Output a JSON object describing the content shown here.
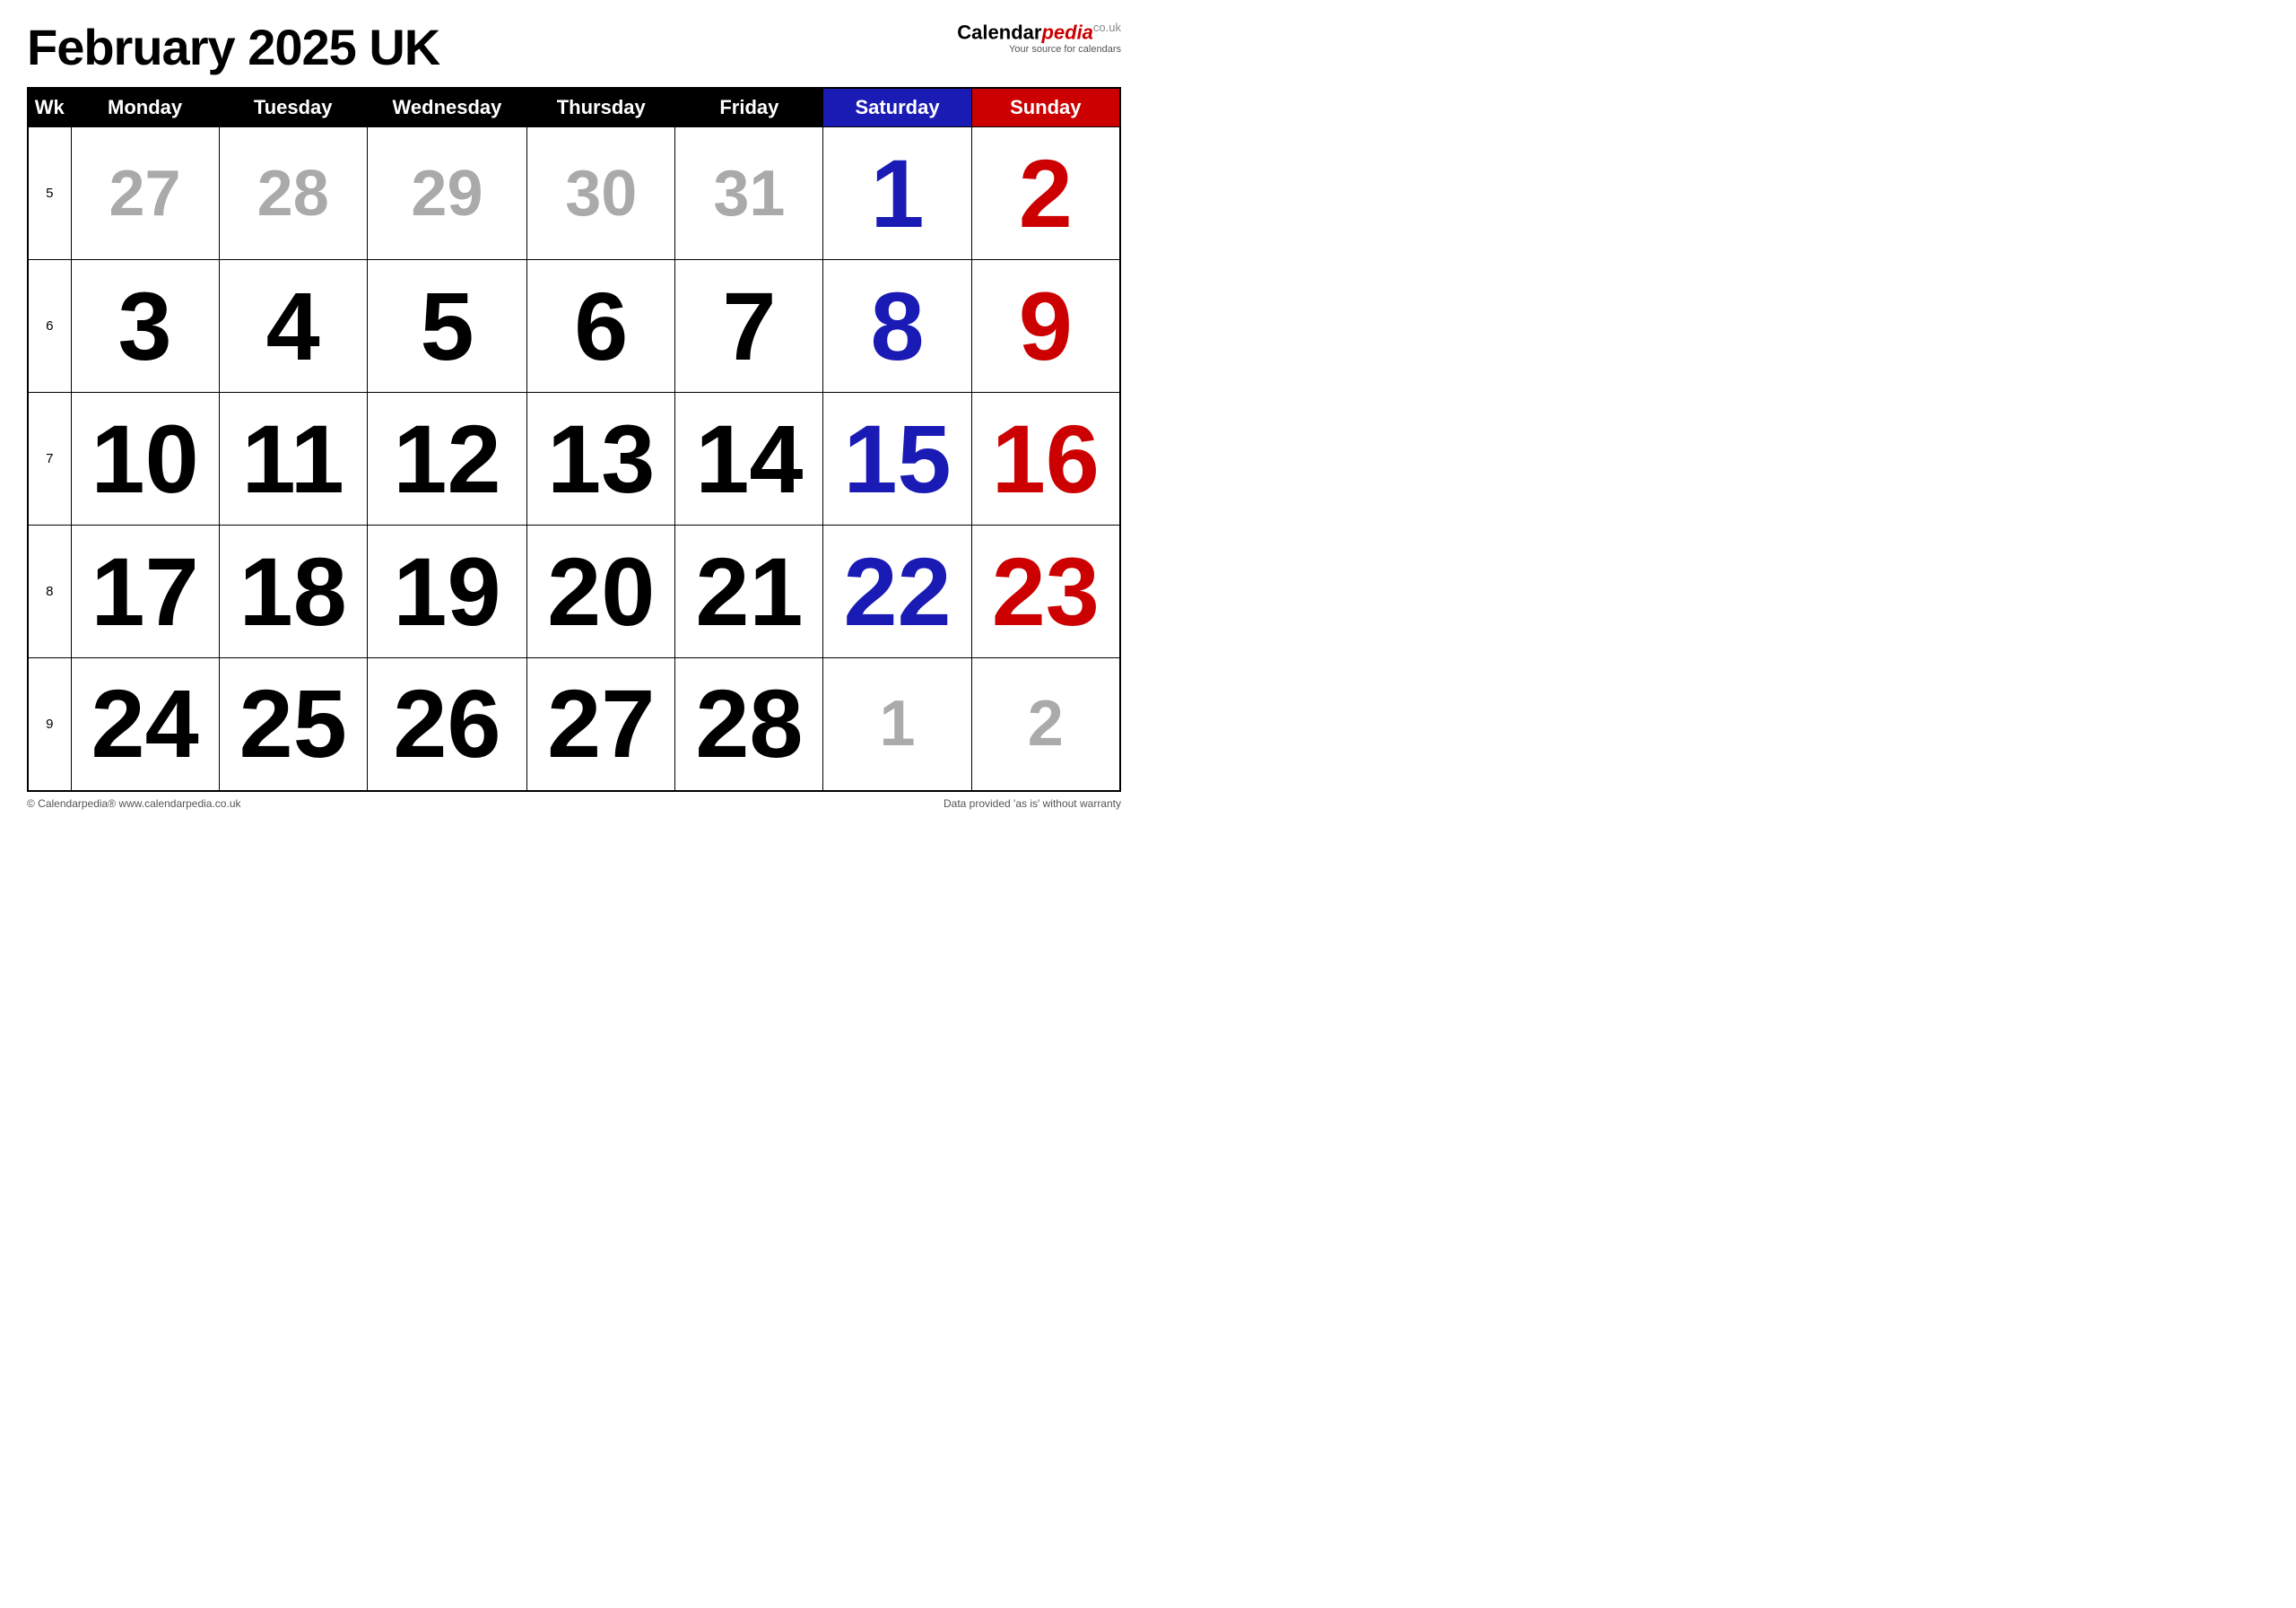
{
  "header": {
    "title": "February 2025 UK",
    "logo_calendar": "Calendar",
    "logo_pedia": "pedia",
    "logo_co_uk": "co.uk",
    "logo_tagline": "Your source for calendars"
  },
  "columns": {
    "wk": "Wk",
    "monday": "Monday",
    "tuesday": "Tuesday",
    "wednesday": "Wednesday",
    "thursday": "Thursday",
    "friday": "Friday",
    "saturday": "Saturday",
    "sunday": "Sunday"
  },
  "weeks": [
    {
      "wk": "5",
      "days": [
        {
          "num": "27",
          "color": "gray"
        },
        {
          "num": "28",
          "color": "gray"
        },
        {
          "num": "29",
          "color": "gray"
        },
        {
          "num": "30",
          "color": "gray"
        },
        {
          "num": "31",
          "color": "gray"
        },
        {
          "num": "1",
          "color": "blue"
        },
        {
          "num": "2",
          "color": "red"
        }
      ]
    },
    {
      "wk": "6",
      "days": [
        {
          "num": "3",
          "color": "black"
        },
        {
          "num": "4",
          "color": "black"
        },
        {
          "num": "5",
          "color": "black"
        },
        {
          "num": "6",
          "color": "black"
        },
        {
          "num": "7",
          "color": "black"
        },
        {
          "num": "8",
          "color": "blue"
        },
        {
          "num": "9",
          "color": "red"
        }
      ]
    },
    {
      "wk": "7",
      "days": [
        {
          "num": "10",
          "color": "black"
        },
        {
          "num": "11",
          "color": "black"
        },
        {
          "num": "12",
          "color": "black"
        },
        {
          "num": "13",
          "color": "black"
        },
        {
          "num": "14",
          "color": "black"
        },
        {
          "num": "15",
          "color": "blue"
        },
        {
          "num": "16",
          "color": "red"
        }
      ]
    },
    {
      "wk": "8",
      "days": [
        {
          "num": "17",
          "color": "black"
        },
        {
          "num": "18",
          "color": "black"
        },
        {
          "num": "19",
          "color": "black"
        },
        {
          "num": "20",
          "color": "black"
        },
        {
          "num": "21",
          "color": "black"
        },
        {
          "num": "22",
          "color": "blue"
        },
        {
          "num": "23",
          "color": "red"
        }
      ]
    },
    {
      "wk": "9",
      "days": [
        {
          "num": "24",
          "color": "black"
        },
        {
          "num": "25",
          "color": "black"
        },
        {
          "num": "26",
          "color": "black"
        },
        {
          "num": "27",
          "color": "black"
        },
        {
          "num": "28",
          "color": "black"
        },
        {
          "num": "1",
          "color": "gray"
        },
        {
          "num": "2",
          "color": "gray"
        }
      ]
    }
  ],
  "footer": {
    "left": "© Calendarpedia®  www.calendarpedia.co.uk",
    "right": "Data provided 'as is' without warranty"
  }
}
